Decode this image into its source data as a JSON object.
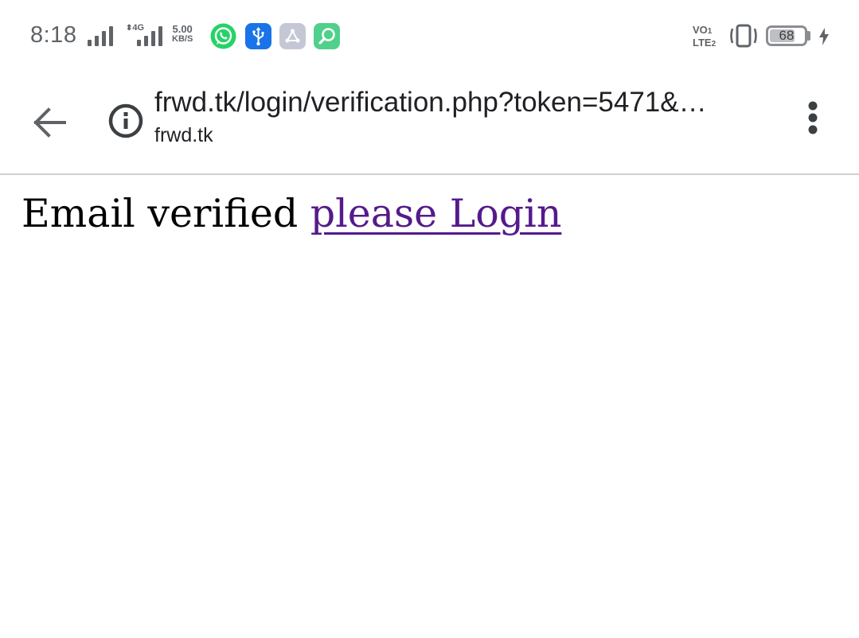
{
  "status_bar": {
    "time": "8:18",
    "network_type": "4G",
    "speed_value": "5.00",
    "speed_unit": "KB/S",
    "volte_line1": "VO",
    "volte_line2": "LTE",
    "sim1": "1",
    "sim2": "2",
    "battery_level": "68",
    "notification_icons": [
      "whatsapp-icon",
      "usb-icon",
      "share-icon",
      "search-app-icon"
    ]
  },
  "toolbar": {
    "url": "frwd.tk/login/verification.php?token=5471&…",
    "domain": "frwd.tk",
    "back_icon": "arrow-left-icon",
    "info_icon": "info-icon",
    "menu_icon": "more-vert-icon"
  },
  "page": {
    "message": "Email verified",
    "link_text": "please Login"
  },
  "colors": {
    "link": "#551a8b",
    "icon_gray": "#5f6368",
    "whatsapp": "#25d366",
    "usb": "#1a73e8",
    "share": "#c5c8d4",
    "search_app": "#4fd18b"
  }
}
